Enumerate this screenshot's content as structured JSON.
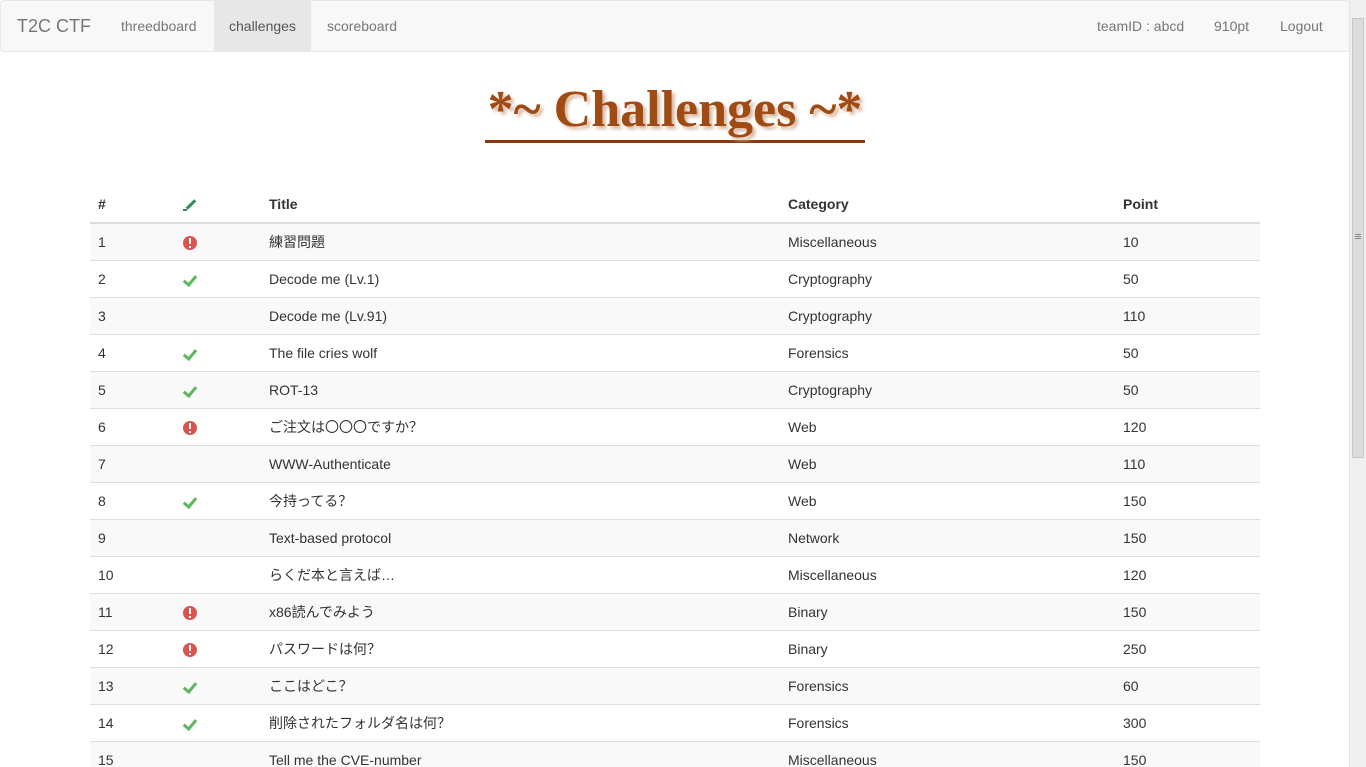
{
  "navbar": {
    "brand": "T2C CTF",
    "items": [
      {
        "label": "threedboard",
        "active": false
      },
      {
        "label": "challenges",
        "active": true
      },
      {
        "label": "scoreboard",
        "active": false
      }
    ],
    "right": {
      "team": "teamID : abcd",
      "points": "910pt",
      "logout": "Logout"
    }
  },
  "page": {
    "title": "*~ Challenges ~*"
  },
  "table": {
    "headers": {
      "num": "#",
      "status_icon": "pencil-icon",
      "title": "Title",
      "category": "Category",
      "point": "Point"
    },
    "rows": [
      {
        "num": "1",
        "status": "alert",
        "title": "練習問題",
        "category": "Miscellaneous",
        "point": "10"
      },
      {
        "num": "2",
        "status": "check",
        "title": "Decode me (Lv.1)",
        "category": "Cryptography",
        "point": "50"
      },
      {
        "num": "3",
        "status": "none",
        "title": "Decode me (Lv.91)",
        "category": "Cryptography",
        "point": "110"
      },
      {
        "num": "4",
        "status": "check",
        "title": "The file cries wolf",
        "category": "Forensics",
        "point": "50"
      },
      {
        "num": "5",
        "status": "check",
        "title": "ROT-13",
        "category": "Cryptography",
        "point": "50"
      },
      {
        "num": "6",
        "status": "alert",
        "title": "ご注文は〇〇〇ですか？",
        "category": "Web",
        "point": "120"
      },
      {
        "num": "7",
        "status": "none",
        "title": "WWW-Authenticate",
        "category": "Web",
        "point": "110"
      },
      {
        "num": "8",
        "status": "check",
        "title": "今持ってる？",
        "category": "Web",
        "point": "150"
      },
      {
        "num": "9",
        "status": "none",
        "title": "Text-based protocol",
        "category": "Network",
        "point": "150"
      },
      {
        "num": "10",
        "status": "none",
        "title": "らくだ本と言えば…",
        "category": "Miscellaneous",
        "point": "120"
      },
      {
        "num": "11",
        "status": "alert",
        "title": "x86読んでみよう",
        "category": "Binary",
        "point": "150"
      },
      {
        "num": "12",
        "status": "alert",
        "title": "パスワードは何？",
        "category": "Binary",
        "point": "250"
      },
      {
        "num": "13",
        "status": "check",
        "title": "ここはどこ？",
        "category": "Forensics",
        "point": "60"
      },
      {
        "num": "14",
        "status": "check",
        "title": "削除されたフォルダ名は何？",
        "category": "Forensics",
        "point": "300"
      },
      {
        "num": "15",
        "status": "none",
        "title": "Tell me the CVE-number",
        "category": "Miscellaneous",
        "point": "150"
      }
    ]
  },
  "colors": {
    "title": "#a04a14",
    "alert": "#d9534f",
    "check": "#5cb85c",
    "pencil": "#2e8b57"
  }
}
